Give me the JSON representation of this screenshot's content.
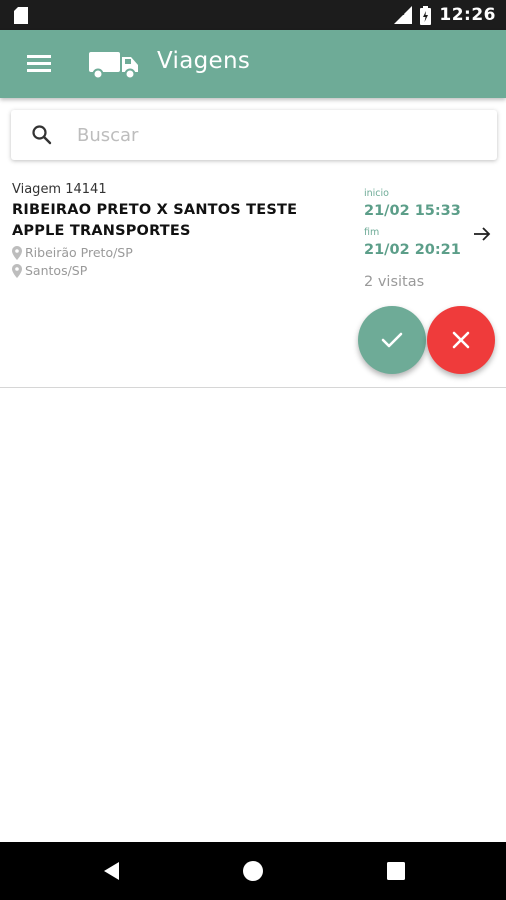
{
  "status_bar": {
    "time": "12:26",
    "icons": [
      "sd-card-icon",
      "lte-signal-icon",
      "battery-charging-icon"
    ]
  },
  "app_bar": {
    "title": "Viagens",
    "menu_icon": "menu-icon",
    "logo_icon": "truck-icon",
    "color": "#6eab97"
  },
  "search": {
    "placeholder": "Buscar",
    "value": ""
  },
  "trips": [
    {
      "id_label": "Viagem 14141",
      "title": "RIBEIRAO PRETO X SANTOS TESTE APPLE TRANSPORTES",
      "origin": "Ribeirão Preto/SP",
      "destination": "Santos/SP",
      "start_label": "inicio",
      "start": "21/02 15:33",
      "end_label": "fim",
      "end": "21/02 20:21",
      "visits": "2 visitas"
    }
  ],
  "colors": {
    "accent": "#6eab97",
    "danger": "#ef3b3b"
  }
}
